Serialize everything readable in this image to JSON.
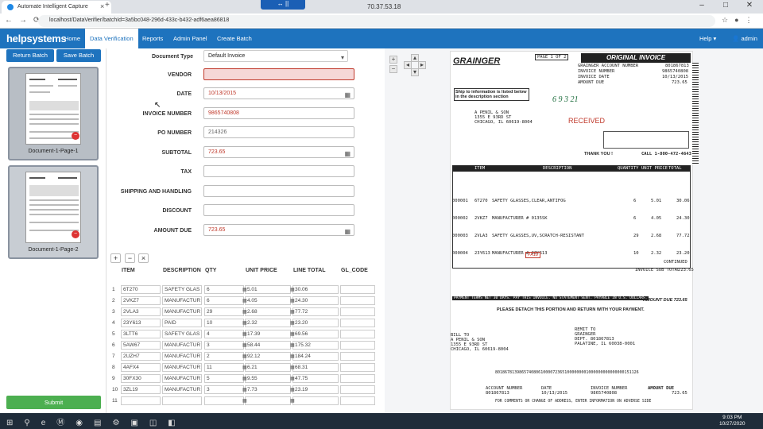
{
  "browser": {
    "tab_title": "Automate Intelligent Capture",
    "remote_label": "↔ ||",
    "remote_ip": "70.37.53.18",
    "url": "localhost/DataVerifier/batchId=3a5bc048-296d-433c-b432-adf6aea86818"
  },
  "app": {
    "logo": "helpsystems",
    "nav": [
      "Home",
      "Data Verification",
      "Reports",
      "Admin Panel",
      "Create Batch"
    ],
    "help": "Help ▾",
    "user": "admin ▾"
  },
  "left": {
    "return_label": "Return Batch",
    "save_label": "Save Batch",
    "pages": [
      "Document-1-Page-1",
      "Document-1-Page-2"
    ],
    "submit_label": "Submit"
  },
  "form": {
    "doc_type_label": "Document Type",
    "doc_type_value": "Default Invoice",
    "fields": [
      {
        "label": "VENDOR",
        "value": ""
      },
      {
        "label": "DATE",
        "value": "10/13/2015"
      },
      {
        "label": "INVOICE NUMBER",
        "value": "9865740808"
      },
      {
        "label": "PO NUMBER",
        "value": "214326"
      },
      {
        "label": "SUBTOTAL",
        "value": "723.65"
      },
      {
        "label": "TAX",
        "value": ""
      },
      {
        "label": "SHIPPING AND HANDLING",
        "value": ""
      },
      {
        "label": "DISCOUNT",
        "value": ""
      },
      {
        "label": "AMOUNT DUE",
        "value": "723.65"
      }
    ]
  },
  "table": {
    "headers": [
      "ITEM",
      "DESCRIPTION",
      "QTY",
      "UNIT PRICE",
      "LINE TOTAL",
      "GL_CODE"
    ],
    "rows": [
      [
        "1",
        "6T270",
        "SAFETY GLAS",
        "6",
        "5.01",
        "30.06",
        ""
      ],
      [
        "2",
        "2VKZ7",
        "MANUFACTUR",
        "6",
        "4.05",
        "24.30",
        ""
      ],
      [
        "3",
        "2VLA3",
        "MANUFACTUR",
        "29",
        "2.68",
        "77.72",
        ""
      ],
      [
        "4",
        "23Y613",
        "PAID",
        "10",
        "2.32",
        "23.20",
        ""
      ],
      [
        "5",
        "3LTT6",
        "SAFETY GLAS",
        "4",
        "17.39",
        "69.56",
        ""
      ],
      [
        "6",
        "5AW67",
        "MANUFACTUR",
        "3",
        "58.44",
        "175.32",
        ""
      ],
      [
        "7",
        "2UZH7",
        "MANUFACTUR",
        "2",
        "92.12",
        "184.24",
        ""
      ],
      [
        "8",
        "4AFX4",
        "MANUFACTUR",
        "11",
        "6.21",
        "68.31",
        ""
      ],
      [
        "9",
        "30FX30",
        "MANUFACTUR",
        "5",
        "9.55",
        "47.75",
        ""
      ],
      [
        "10",
        "3ZL19",
        "MANUFACTUR",
        "3",
        "7.73",
        "23.19",
        ""
      ],
      [
        "11",
        "",
        "",
        "",
        "",
        "",
        ""
      ]
    ]
  },
  "document": {
    "brand": "GRAINGER",
    "page": "PAGE 1 OF 2",
    "heading": "ORIGINAL INVOICE",
    "acct_label": "GRAINGER ACCOUNT NUMBER",
    "acct_value": "801867813",
    "inv_label": "INVOICE NUMBER",
    "inv_value": "9865740808",
    "inv_date_label": "INVOICE DATE",
    "inv_date": "10/13/2015",
    "amount_due_label": "AMOUNT DUE",
    "amount_due": "723.65",
    "ship_note": "Ship to information is listed below in the description section",
    "billto": [
      "A PENIL & SON",
      "1355 E 93RD ST",
      "CHICAGO, IL 60619-8004"
    ],
    "stamp": "RECEIVED",
    "thank_you": "THANK YOU !",
    "call": "CALL 1-800-472-4643",
    "col_heads": [
      "ITEM",
      "DESCRIPTION",
      "QUANTITY",
      "UNIT PRICE",
      "TOTAL"
    ],
    "lines": [
      {
        "no": "000001",
        "item": "6T270",
        "desc": "SAFETY GLASSES,CLEAR,ANTIFOG",
        "qty": "6",
        "price": "5.01",
        "total": "30.06"
      },
      {
        "no": "000002",
        "item": "2VKZ7",
        "desc": "MANUFACTURER # 0135SK",
        "qty": "6",
        "price": "4.05",
        "total": "24.30"
      },
      {
        "no": "000003",
        "item": "2VLA3",
        "desc": "SAFETY GLASSES,UV,SCRATCH-RESISTANT",
        "qty": "29",
        "price": "2.68",
        "total": "77.72"
      },
      {
        "no": "000004",
        "item": "23Y613",
        "desc": "MANUFACTURER # 23Y613",
        "qty": "10",
        "price": "2.32",
        "total": "23.20"
      }
    ],
    "continued": "CONTINUED",
    "subtotal_label": "INVOICE SUB TOTAL",
    "subtotal": "723.65",
    "payment_terms": "PAYMENT TERMS NET 30 DAYS. PAY THIS INVOICE. NO STATEMENT SENT. PAYABLE IN U.S. DOLLARS.",
    "amount_due_2": "AMOUNT DUE 723.65",
    "detach": "PLEASE DETACH THIS PORTION AND RETURN WITH YOUR PAYMENT.",
    "remit": [
      "REMIT TO",
      "GRAINGER",
      "DEPT. 801867813",
      "PALATINE, IL 60038-0001"
    ],
    "billto2": [
      "BILL TO",
      "A PENIL & SON",
      "1355 E 93RD ST",
      "CHICAGO, IL 60619-8004"
    ],
    "barcode": "801867813986574080610000723651000000001000000000000000151126",
    "foot_acct": "801867813",
    "foot_date": "10/13/2015",
    "foot_inv": "9865740808",
    "foot_due": "723.65",
    "foot_labels": [
      "ACCOUNT NUMBER",
      "DATE",
      "INVOICE NUMBER",
      "AMOUNT DUE"
    ],
    "footer_note": "FOR COMMENTS OR CHANGE OF ADDRESS, ENTER INFORMATION ON ADVERSE SIDE",
    "handwriting": "6 9 3 21",
    "paid": "PAID"
  },
  "taskbar": {
    "time": "9:03 PM",
    "date": "10/27/2020"
  }
}
